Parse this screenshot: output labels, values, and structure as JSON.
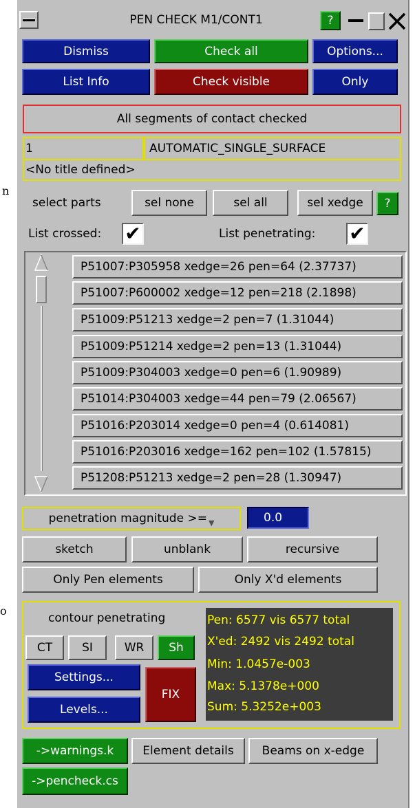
{
  "window": {
    "title": "PEN CHECK M1/CONT1",
    "help_label": "?"
  },
  "edge_text": {
    "line1": "n",
    "line2": "o"
  },
  "buttons": {
    "dismiss": "Dismiss",
    "check_all": "Check all",
    "options": "Options...",
    "list_info": "List Info",
    "check_visible": "Check visible",
    "only": "Only"
  },
  "status": "All segments of contact checked",
  "contact": {
    "id": "1",
    "type": "AUTOMATIC_SINGLE_SURFACE",
    "title": "<No title defined>"
  },
  "select_parts": {
    "label": "select parts",
    "sel_none": "sel none",
    "sel_all": "sel all",
    "sel_xedge": "sel xedge",
    "help": "?"
  },
  "list_crossed": {
    "label": "List crossed:",
    "checked": true
  },
  "list_penetrating": {
    "label": "List penetrating:",
    "checked": true
  },
  "results": [
    "P51007:P305958 xedge=26 pen=64 (2.37737)",
    "P51007:P600002 xedge=12 pen=218 (2.1898)",
    "P51009:P51213 xedge=2 pen=7 (1.31044)",
    "P51009:P51214 xedge=2 pen=13 (1.31044)",
    "P51009:P304003 xedge=0 pen=6 (1.90989)",
    "P51014:P304003 xedge=44 pen=79 (2.06567)",
    "P51016:P203014 xedge=0 pen=4 (0.614081)",
    "P51016:P203016 xedge=162 pen=102 (1.57815)",
    "P51208:P51213 xedge=2 pen=28 (1.30947)"
  ],
  "threshold": {
    "label": "penetration magnitude >=",
    "value": "0.0"
  },
  "actions": {
    "sketch": "sketch",
    "unblank": "unblank",
    "recursive": "recursive",
    "only_pen": "Only Pen elements",
    "only_xd": "Only X'd elements"
  },
  "contour": {
    "label": "contour penetrating",
    "ct": "CT",
    "si": "SI",
    "wr": "WR",
    "sh": "Sh",
    "settings": "Settings...",
    "levels": "Levels...",
    "fix": "FIX"
  },
  "stats": {
    "pen": "Pen: 6577 vis 6577 total",
    "xed": "X'ed: 2492 vis 2492 total",
    "min": "Min:  1.0457e-003",
    "max": "Max:  5.1378e+000",
    "sum": "Sum:  5.3252e+003"
  },
  "bottom": {
    "warnings": "->warnings.k",
    "element_details": "Element details",
    "beams": "Beams on x-edge",
    "pencheck": "->pencheck.cs"
  },
  "colors": {
    "panel": "#c0c0c0",
    "blue_button": "#0b1b8e",
    "green_button": "#0f8a14",
    "red_button": "#8b0b0b",
    "stats_bg": "#3c3c3c",
    "stats_text": "#ffff00",
    "outline_yellow": "#e0e000",
    "outline_red": "#e03030"
  }
}
